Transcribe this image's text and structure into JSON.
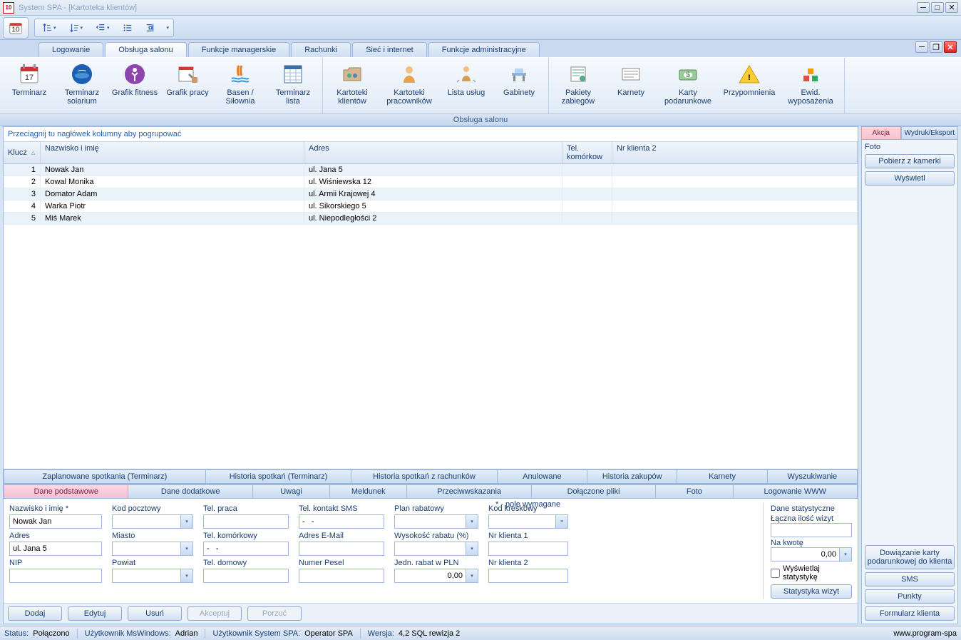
{
  "window": {
    "title": "System SPA  - [Kartoteka klientów]"
  },
  "tabs": {
    "logowanie": "Logowanie",
    "obsluga": "Obsługa salonu",
    "manager": "Funkcje managerskie",
    "rachunki": "Rachunki",
    "siec": "Sieć i internet",
    "admin": "Funkcje administracyjne"
  },
  "ribbon": {
    "caption": "Obsługa salonu",
    "items": {
      "terminarz": "Terminarz",
      "solarium": "Terminarz solarium",
      "fitness": "Grafik fitness",
      "grafik_pracy": "Grafik pracy",
      "basen": "Basen / Siłownia",
      "terminarz_lista": "Terminarz lista",
      "kart_klientow": "Kartoteki klientów",
      "kart_prac": "Kartoteki pracowników",
      "lista_uslug": "Lista usług",
      "gabinety": "Gabinety",
      "pakiety": "Pakiety zabiegów",
      "karnety": "Karnety",
      "karty_pod": "Karty podarunkowe",
      "przypomnienia": "Przypomnienia",
      "ewid": "Ewid. wyposażenia"
    }
  },
  "grid": {
    "group_hint": "Przeciągnij tu nagłówek kolumny aby pogrupować",
    "headers": {
      "klucz": "Klucz",
      "name": "Nazwisko i imię",
      "adres": "Adres",
      "tel": "Tel. komórkow",
      "nr": "Nr klienta 2"
    },
    "rows": [
      {
        "k": "1",
        "n": "Nowak Jan",
        "a": "ul. Jana 5"
      },
      {
        "k": "2",
        "n": "Kowal Monika",
        "a": "ul. Wiśniewska 12"
      },
      {
        "k": "3",
        "n": "Domator Adam",
        "a": "ul. Armii Krajowej 4"
      },
      {
        "k": "4",
        "n": "Warka Piotr",
        "a": "ul. Sikorskiego 5"
      },
      {
        "k": "5",
        "n": "Miś Marek",
        "a": "ul. Niepodległości 2"
      }
    ]
  },
  "side": {
    "tab_akcja": "Akcja",
    "tab_wydruk": "Wydruk/Eksport",
    "foto": "Foto",
    "pobierz": "Pobierz z kamerki",
    "wyswietl": "Wyświetl",
    "dowiazanie": "Dowiązanie karty podarunkowej do klienta",
    "sms": "SMS",
    "punkty": "Punkty",
    "formularz": "Formularz klienta"
  },
  "midtabs1": {
    "zaplanowane": "Zaplanowane spotkania (Terminarz)",
    "historia_sp": "Historia spotkań (Terminarz)",
    "historia_rach": "Historia spotkań z rachunków",
    "anulowane": "Anulowane",
    "historia_zak": "Historia zakupów",
    "karnety": "Karnety",
    "wyszukiwanie": "Wyszukiwanie"
  },
  "midtabs2": {
    "dane_podst": "Dane podstawowe",
    "dane_dod": "Dane dodatkowe",
    "uwagi": "Uwagi",
    "meldunek": "Meldunek",
    "przeciw": "Przeciwwskazania",
    "pliki": "Dołączone pliki",
    "foto": "Foto",
    "logowanie": "Logowanie WWW"
  },
  "form": {
    "req_note": "* - pole wymagane",
    "labels": {
      "nazwisko": "Nazwisko i imię *",
      "adres": "Adres",
      "nip": "NIP",
      "kod": "Kod pocztowy",
      "miasto": "Miasto",
      "powiat": "Powiat",
      "tel_praca": "Tel. praca",
      "tel_kom": "Tel. komórkowy",
      "tel_dom": "Tel. domowy",
      "tel_sms": "Tel. kontakt SMS",
      "email": "Adres E-Mail",
      "pesel": "Numer Pesel",
      "plan": "Plan rabatowy",
      "wysokosc": "Wysokość rabatu (%)",
      "jedn": "Jedn. rabat w PLN",
      "kreskowy": "Kod kreskowy",
      "nr1": "Nr klienta 1",
      "nr2": "Nr klienta 2"
    },
    "values": {
      "nazwisko": "Nowak Jan",
      "adres": "ul. Jana 5",
      "tel_sms": "-   -",
      "tel_kom": "-   -",
      "jedn": "0,00"
    },
    "stats": {
      "title": "Dane statystyczne",
      "laczna": "Łączna ilość wizyt",
      "nakwote": "Na kwotę",
      "nakwote_val": "0,00",
      "checkbox": "Wyświetlaj statystykę",
      "btn": "Statystyka wizyt"
    }
  },
  "actions": {
    "dodaj": "Dodaj",
    "edytuj": "Edytuj",
    "usun": "Usuń",
    "akceptuj": "Akceptuj",
    "porzuc": "Porzuć"
  },
  "status": {
    "status_lbl": "Status:",
    "status_val": "Połączono",
    "userw_lbl": "Użytkownik MsWindows:",
    "userw_val": "Adrian",
    "users_lbl": "Użytkownik System SPA:",
    "users_val": "Operator SPA",
    "wersja_lbl": "Wersja:",
    "wersja_val": "4,2 SQL rewizja 2",
    "url": "www.program-spa"
  }
}
